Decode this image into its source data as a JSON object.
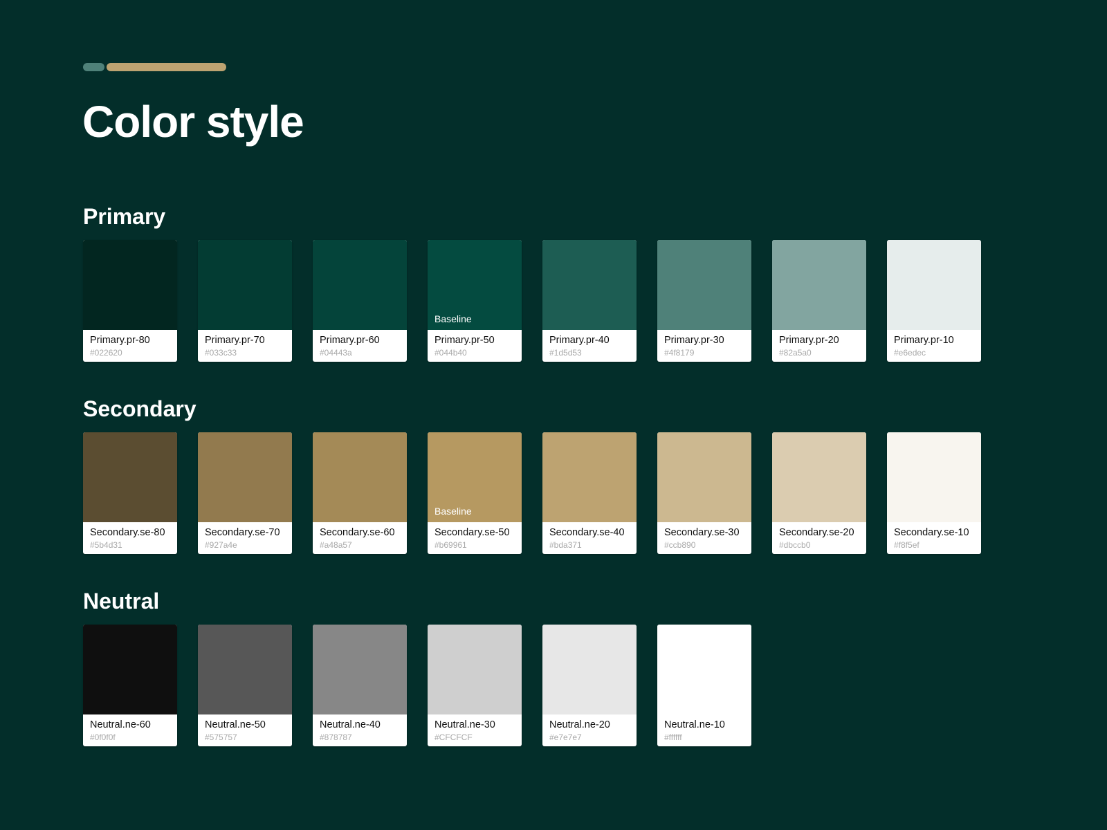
{
  "page": {
    "title": "Color style",
    "background": "#032e2a",
    "accent_colors": [
      "#4f8179",
      "#bda371"
    ]
  },
  "sections": [
    {
      "title": "Primary",
      "swatches": [
        {
          "name": "Primary.pr-80",
          "hex": "#022620",
          "color": "#022620",
          "label": ""
        },
        {
          "name": "Primary.pr-70",
          "hex": "#033c33",
          "color": "#033c33",
          "label": ""
        },
        {
          "name": "Primary.pr-60",
          "hex": "#04443a",
          "color": "#04443a",
          "label": ""
        },
        {
          "name": "Primary.pr-50",
          "hex": "#044b40",
          "color": "#044b40",
          "label": "Baseline"
        },
        {
          "name": "Primary.pr-40",
          "hex": "#1d5d53",
          "color": "#1d5d53",
          "label": ""
        },
        {
          "name": "Primary.pr-30",
          "hex": "#4f8179",
          "color": "#4f8179",
          "label": ""
        },
        {
          "name": "Primary.pr-20",
          "hex": "#82a5a0",
          "color": "#82a5a0",
          "label": ""
        },
        {
          "name": "Primary.pr-10",
          "hex": "#e6edec",
          "color": "#e6edec",
          "label": ""
        }
      ]
    },
    {
      "title": "Secondary",
      "swatches": [
        {
          "name": "Secondary.se-80",
          "hex": "#5b4d31",
          "color": "#5b4d31",
          "label": ""
        },
        {
          "name": "Secondary.se-70",
          "hex": "#927a4e",
          "color": "#927a4e",
          "label": ""
        },
        {
          "name": "Secondary.se-60",
          "hex": "#a48a57",
          "color": "#a48a57",
          "label": ""
        },
        {
          "name": "Secondary.se-50",
          "hex": "#b69961",
          "color": "#b69961",
          "label": "Baseline"
        },
        {
          "name": "Secondary.se-40",
          "hex": "#bda371",
          "color": "#bda371",
          "label": ""
        },
        {
          "name": "Secondary.se-30",
          "hex": "#ccb890",
          "color": "#ccb890",
          "label": ""
        },
        {
          "name": "Secondary.se-20",
          "hex": "#dbccb0",
          "color": "#dbccb0",
          "label": ""
        },
        {
          "name": "Secondary.se-10",
          "hex": "#f8f5ef",
          "color": "#f8f5ef",
          "label": ""
        }
      ]
    },
    {
      "title": "Neutral",
      "swatches": [
        {
          "name": "Neutral.ne-60",
          "hex": "#0f0f0f",
          "color": "#0f0f0f",
          "label": ""
        },
        {
          "name": "Neutral.ne-50",
          "hex": "#575757",
          "color": "#575757",
          "label": ""
        },
        {
          "name": "Neutral.ne-40",
          "hex": "#878787",
          "color": "#878787",
          "label": ""
        },
        {
          "name": "Neutral.ne-30",
          "hex": "#CFCFCF",
          "color": "#cfcfcf",
          "label": ""
        },
        {
          "name": "Neutral.ne-20",
          "hex": "#e7e7e7",
          "color": "#e7e7e7",
          "label": ""
        },
        {
          "name": "Neutral.ne-10",
          "hex": "#ffffff",
          "color": "#ffffff",
          "label": ""
        }
      ]
    }
  ]
}
